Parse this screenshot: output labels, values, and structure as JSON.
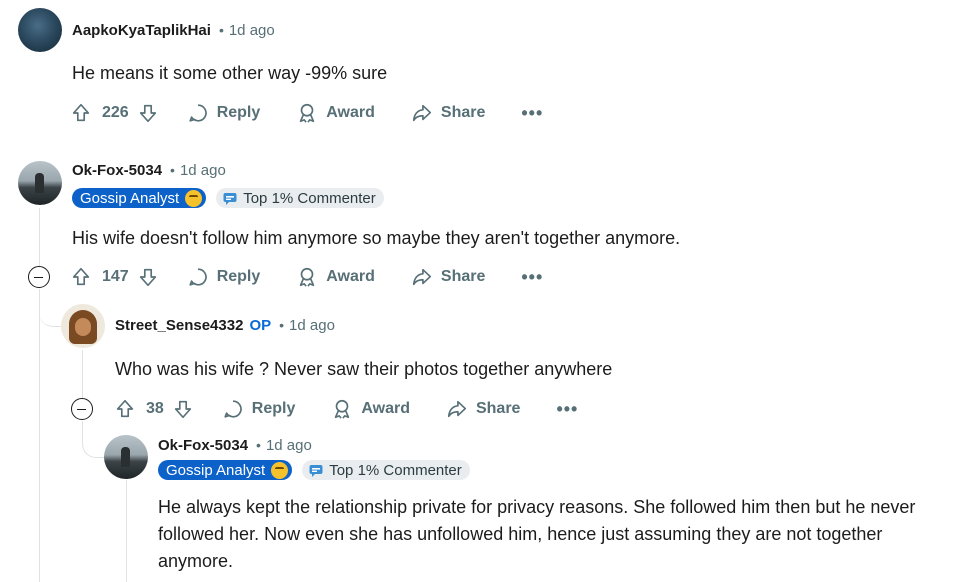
{
  "comments": [
    {
      "username": "AapkoKyaTaplikHai",
      "time": "1d ago",
      "text": "He means it some other way -99% sure",
      "votes": "226",
      "reply_label": "Reply",
      "award_label": "Award",
      "share_label": "Share",
      "more_label": "•••"
    },
    {
      "username": "Ok-Fox-5034",
      "time": "1d ago",
      "flair1": "Gossip Analyst",
      "flair2": "Top 1% Commenter",
      "text": "His wife doesn't follow him anymore so maybe they aren't together anymore.",
      "votes": "147",
      "reply_label": "Reply",
      "award_label": "Award",
      "share_label": "Share",
      "more_label": "•••"
    },
    {
      "username": "Street_Sense4332",
      "op_badge": "OP",
      "time": "1d ago",
      "text": "Who was his wife ? Never saw their photos together anywhere",
      "votes": "38",
      "reply_label": "Reply",
      "award_label": "Award",
      "share_label": "Share",
      "more_label": "•••"
    },
    {
      "username": "Ok-Fox-5034",
      "time": "1d ago",
      "flair1": "Gossip Analyst",
      "flair2": "Top 1% Commenter",
      "text_lines": [
        "He always kept the relationship private for privacy reasons. She followed him then but he never",
        "followed her. Now even she has unfollowed him, hence just assuming they are not together",
        "anymore."
      ]
    }
  ],
  "separator_dot": "•",
  "colors": {
    "text": "#1c1c1c",
    "muted": "#576f76",
    "op_blue": "#0a6bd6",
    "flair_blue": "#0d62c9",
    "flair_grey": "#eaedef",
    "thread_line": "#dfe2e4"
  }
}
